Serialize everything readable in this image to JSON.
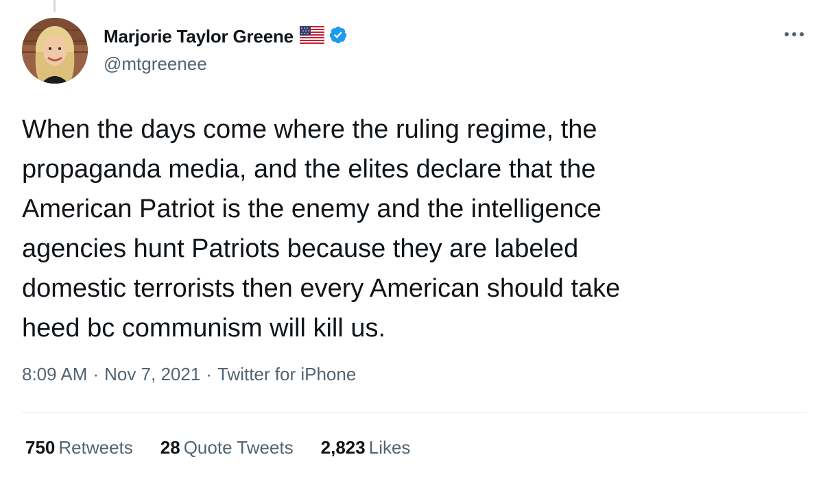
{
  "tweet": {
    "author": {
      "display_name": "Marjorie Taylor Greene",
      "flag_emoji": "flag-usa-icon",
      "verified": true,
      "handle": "@mtgreenee"
    },
    "text": "When the days come where the ruling regime, the\npropaganda media, and the elites declare that the\nAmerican Patriot is the enemy and the intelligence\nagencies hunt Patriots because they are labeled\ndomestic terrorists then every American should take\nheed bc communism will kill us.",
    "time": "8:09 AM",
    "date": "Nov 7, 2021",
    "source": "Twitter for iPhone",
    "separator": "·",
    "stats": {
      "retweets_count": "750",
      "retweets_label": "Retweets",
      "quotes_count": "28",
      "quotes_label": "Quote Tweets",
      "likes_count": "2,823",
      "likes_label": "Likes"
    }
  },
  "colors": {
    "text_primary": "#0f1419",
    "text_secondary": "#536471",
    "verified_blue": "#1d9bf0",
    "divider": "#e6ecf0"
  },
  "icons": {
    "more": "more-horizontal-icon",
    "verified": "verified-badge-icon",
    "flag": "flag-usa-icon"
  }
}
